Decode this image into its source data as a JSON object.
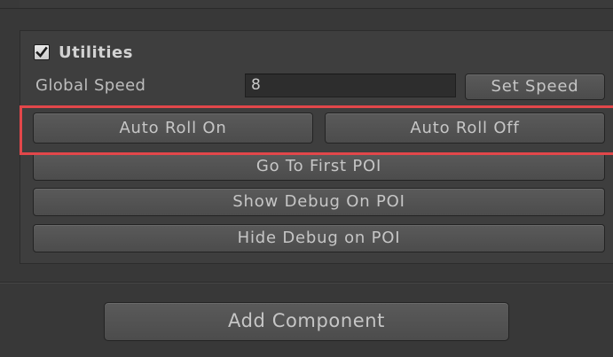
{
  "component": {
    "title": "Utilities",
    "enabled": true
  },
  "fields": {
    "global_speed_label": "Global Speed",
    "global_speed_value": "8"
  },
  "buttons": {
    "set_speed": "Set Speed",
    "auto_roll_on": "Auto Roll On",
    "auto_roll_off": "Auto Roll Off",
    "go_to_first_poi": "Go To First POI",
    "show_debug_on_poi": "Show Debug On POI",
    "hide_debug_on_poi": "Hide Debug on POI",
    "add_component": "Add Component"
  },
  "colors": {
    "panel_background": "#3e3e3e",
    "button_background": "#545454",
    "highlight": "#e2474a",
    "text": "#c4c4c4"
  },
  "icons": {
    "checkbox": "checkmark-icon"
  }
}
